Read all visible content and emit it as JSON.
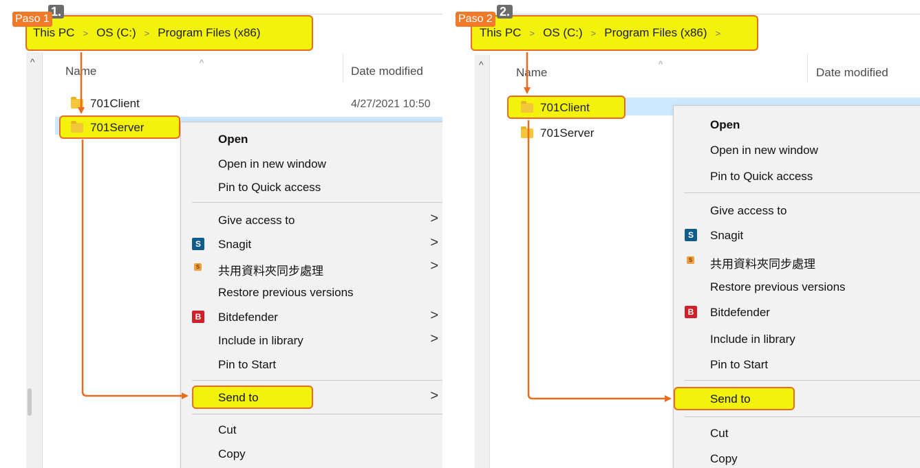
{
  "panel1": {
    "step_label": "Paso 1",
    "step_number": "1.",
    "breadcrumb": [
      "This PC",
      "OS (C:)",
      "Program Files (x86)"
    ],
    "col_name": "Name",
    "col_date": "Date modified",
    "files": [
      {
        "name": "701Client",
        "date": "4/27/2021 10:50"
      },
      {
        "name": "701Server",
        "date": ""
      }
    ],
    "selected": "701Server"
  },
  "panel2": {
    "step_label": "Paso 2",
    "step_number": "2.",
    "breadcrumb": [
      "This PC",
      "OS (C:)",
      "Program Files (x86)"
    ],
    "col_name": "Name",
    "col_date": "Date modified",
    "files": [
      {
        "name": "701Client",
        "date": ""
      },
      {
        "name": "701Server",
        "date": ""
      }
    ],
    "selected": "701Client"
  },
  "context_menu": {
    "open": "Open",
    "open_new_window": "Open in new window",
    "pin_quick_access": "Pin to Quick access",
    "give_access": "Give access to",
    "snagit": "Snagit",
    "sync": "共用資料夾同步處理",
    "restore": "Restore previous versions",
    "bitdefender": "Bitdefender",
    "include_library": "Include in library",
    "pin_start": "Pin to Start",
    "send_to": "Send to",
    "cut": "Cut",
    "copy": "Copy"
  },
  "icons": {
    "snagit_glyph": "S",
    "bitdefender_glyph": "B",
    "sync_glyph": "S",
    "submenu_glyph": ">",
    "breadcrumb_chevron": ">",
    "sort_caret": "^"
  },
  "colors": {
    "highlight_fill": "#f3f20a",
    "highlight_border": "#e86b1f",
    "arrow": "#e86b1f",
    "step_label_bg": "#f07a2a",
    "selection_band": "#cde8ff",
    "snagit_icon": "#0f5d8c",
    "bitdefender_icon": "#d0202a",
    "folder": "#f4c73a"
  }
}
